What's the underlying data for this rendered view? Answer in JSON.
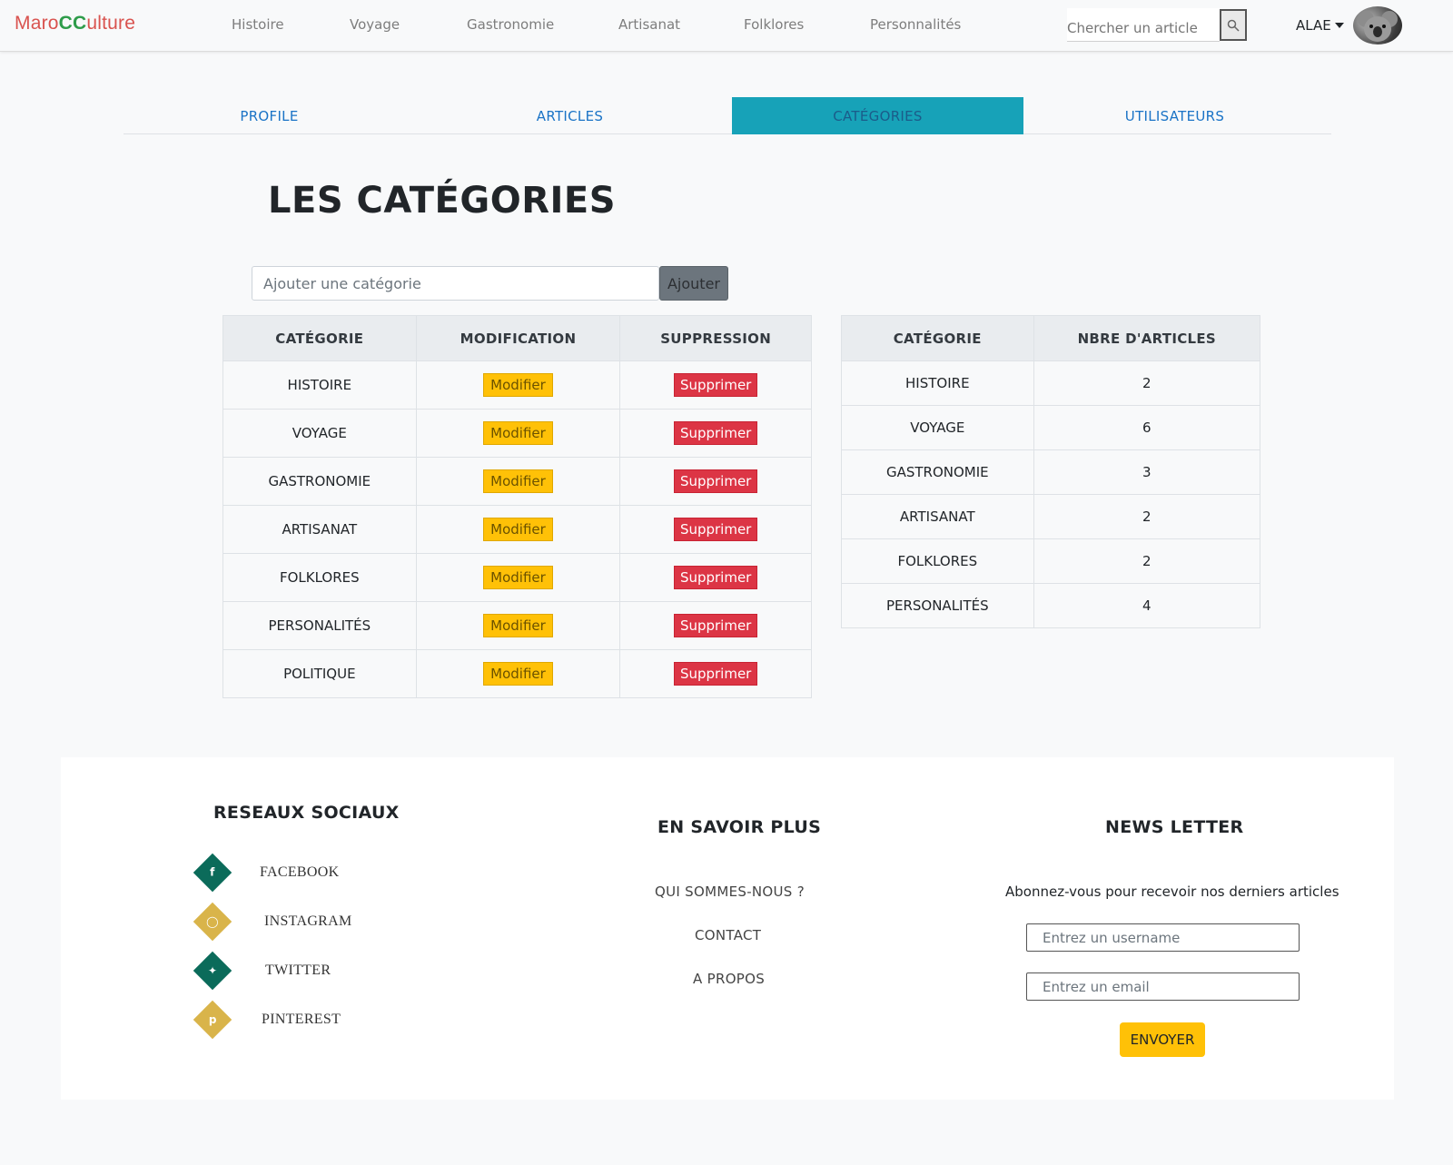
{
  "navbar": {
    "brand_part1": "Maro",
    "brand_part2": "CC",
    "brand_part3": "ulture",
    "links": [
      "Histoire",
      "Voyage",
      "Gastronomie",
      "Artisanat",
      "Folklores",
      "Personnalités"
    ],
    "search_placeholder": "Chercher un article",
    "user": "ALAE"
  },
  "tabs": [
    {
      "label": "PROFILE",
      "active": false
    },
    {
      "label": "ARTICLES",
      "active": false
    },
    {
      "label": "CATÉGORIES",
      "active": true
    },
    {
      "label": "UTILISATEURS",
      "active": false
    }
  ],
  "main": {
    "title": "LES CATÉGORIES",
    "add_placeholder": "Ajouter une catégorie",
    "add_button": "Ajouter"
  },
  "manage_table": {
    "headers": [
      "CATÉGORIE",
      "MODIFICATION",
      "SUPPRESSION"
    ],
    "modify_label": "Modifier",
    "delete_label": "Supprimer",
    "rows": [
      "HISTOIRE",
      "VOYAGE",
      "GASTRONOMIE",
      "ARTISANAT",
      "FOLKLORES",
      "PERSONALITÉS",
      "POLITIQUE"
    ]
  },
  "count_table": {
    "headers": [
      "CATÉGORIE",
      "NBRE D'ARTICLES"
    ],
    "rows": [
      {
        "category": "HISTOIRE",
        "count": "2"
      },
      {
        "category": "VOYAGE",
        "count": "6"
      },
      {
        "category": "GASTRONOMIE",
        "count": "3"
      },
      {
        "category": "ARTISANAT",
        "count": "2"
      },
      {
        "category": "FOLKLORES",
        "count": "2"
      },
      {
        "category": "PERSONALITÉS",
        "count": "4"
      }
    ]
  },
  "footer": {
    "social_title": "RESEAUX SOCIAUX",
    "social": [
      {
        "label": "FACEBOOK",
        "icon": "facebook-icon"
      },
      {
        "label": "INSTAGRAM",
        "icon": "instagram-icon"
      },
      {
        "label": "TWITTER",
        "icon": "twitter-icon"
      },
      {
        "label": "PINTEREST",
        "icon": "pinterest-icon"
      }
    ],
    "more_title": "EN SAVOIR PLUS",
    "more_links": [
      "QUI SOMMES-NOUS ?",
      "CONTACT",
      "A PROPOS"
    ],
    "newsletter_title": "NEWS LETTER",
    "newsletter_text": "Abonnez-vous pour recevoir nos derniers articles",
    "username_placeholder": "Entrez un username",
    "email_placeholder": "Entrez un email",
    "send_button": "ENVOYER"
  },
  "colors": {
    "accent_tab": "#17a2b8",
    "modify": "#ffc107",
    "delete": "#dc3545",
    "social_green": "#0b6b5a",
    "social_gold": "#d9b44a"
  }
}
